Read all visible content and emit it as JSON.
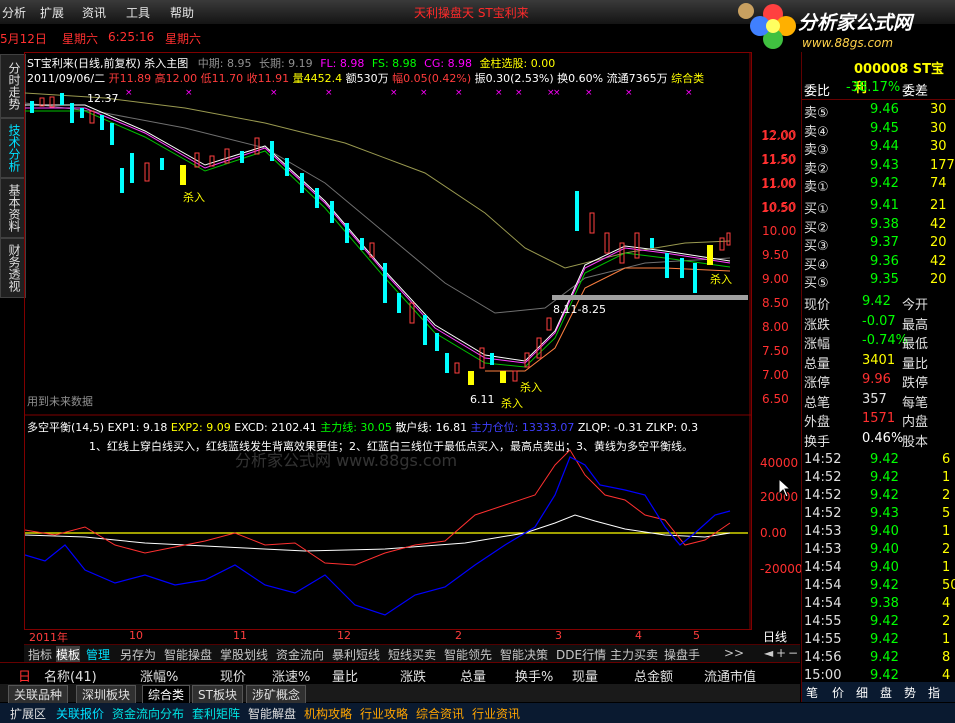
{
  "menu": [
    "分析",
    "扩展",
    "资讯",
    "工具",
    "帮助"
  ],
  "window_title": "天利操盘天 ST宝利来",
  "logo": {
    "text": "分析家公式网",
    "url": "www.88gs.com"
  },
  "datebar": {
    "date1": "5月12日",
    "day1": "星期六",
    "time": "6:25:16",
    "day2": "星期六"
  },
  "side_tabs": [
    "分时走势",
    "技术分析",
    "基本资料",
    "财务透视"
  ],
  "chart_header": {
    "title": "ST宝利来(日线,前复权) 杀入主图",
    "mid": "中期: 8.95",
    "long": "长期: 9.19",
    "fl": "FL: 8.98",
    "fs": "FS: 8.98",
    "cg": "CG: 8.98",
    "gold": "金柱选股: 0.00"
  },
  "quote_line": {
    "date": "2011/09/06/二",
    "open": "开11.89",
    "high": "高12.00",
    "low": "低11.70",
    "close": "收11.91",
    "vol": "量4452.4",
    "amt": "额530万",
    "amp": "幅0.05(0.42%)",
    "swing": "振0.30(2.53%)",
    "turn": "换0.60%",
    "float": "流通7365万",
    "cat": "综合类"
  },
  "price_axis": [
    "12.00",
    "11.50",
    "11.00",
    "10.50",
    "10.00",
    "9.50",
    "9.00",
    "8.50",
    "8.00",
    "7.50",
    "7.00",
    "6.50"
  ],
  "annotations": {
    "top": "12.37",
    "low_range": "8.11-8.25",
    "bottom": "6.11",
    "future": "用到未来数据",
    "buy": "杀入"
  },
  "indicator": {
    "name": "多空平衡(14,5)",
    "exp1": "EXP1: 9.18",
    "exp2": "EXP2: 9.09",
    "excd": "EXCD: 2102.41",
    "main": "主力线: 30.05",
    "retail": "散户线: 16.81",
    "pos": "主力仓位: 13333.07",
    "zlqp": "ZLQP: -0.31",
    "zlkp": "ZLKP: 0.3",
    "note": "1、红线上穿白线买入，红线蓝线发生背离效果更佳；2、红蓝白三线位于最低点买入，最高点卖出；3、黄线为多空平衡线。",
    "watermark": "分析家公式网 www.88gs.com",
    "axis": [
      "40000",
      "20000",
      "0.00",
      "-20000"
    ]
  },
  "time_axis": [
    "2011年",
    "10",
    "11",
    "12",
    "2",
    "3",
    "4",
    "5"
  ],
  "period": "日线",
  "tabbar": [
    "指标",
    "模板",
    "管理",
    "另存为",
    "智能操盘",
    "掌股划线",
    "资金流向",
    "暴利短线",
    "短线买卖",
    "智能领先",
    "智能决策",
    "DDE行情",
    "主力买卖",
    "操盘手",
    ">>"
  ],
  "list_header": [
    "名称(41)",
    "涨幅%",
    "现价",
    "涨速%",
    "量比",
    "涨跌",
    "总量",
    "换手%",
    "现量",
    "总金额",
    "流通市值"
  ],
  "sheet_tabs": [
    "关联品种",
    "深圳板块",
    "综合类",
    "ST板块",
    "涉矿概念"
  ],
  "status_bar": [
    "扩展区",
    "关联报价",
    "资金流向分布",
    "套利矩阵",
    "智能解盘",
    "机构攻略",
    "行业攻略",
    "综合资讯",
    "行业资讯"
  ],
  "right_panel": {
    "code": "000008 ST宝利",
    "weibi_label": "委比",
    "weibi": "-38.17%",
    "weicha": "委差",
    "sells": [
      {
        "label": "卖⑤",
        "price": "9.46",
        "vol": "30"
      },
      {
        "label": "卖④",
        "price": "9.45",
        "vol": "30"
      },
      {
        "label": "卖③",
        "price": "9.44",
        "vol": "30"
      },
      {
        "label": "卖②",
        "price": "9.43",
        "vol": "177"
      },
      {
        "label": "卖①",
        "price": "9.42",
        "vol": "74"
      }
    ],
    "buys": [
      {
        "label": "买①",
        "price": "9.41",
        "vol": "21"
      },
      {
        "label": "买②",
        "price": "9.38",
        "vol": "42"
      },
      {
        "label": "买③",
        "price": "9.37",
        "vol": "20"
      },
      {
        "label": "买④",
        "price": "9.36",
        "vol": "42"
      },
      {
        "label": "买⑤",
        "price": "9.35",
        "vol": "20"
      }
    ],
    "stats": [
      {
        "l": "现价",
        "v": "9.42",
        "r": "今开"
      },
      {
        "l": "涨跌",
        "v": "-0.07",
        "r": "最高"
      },
      {
        "l": "涨幅",
        "v": "-0.74%",
        "r": "最低"
      },
      {
        "l": "总量",
        "v": "3401",
        "r": "量比"
      },
      {
        "l": "涨停",
        "v": "9.96",
        "r": "跌停"
      },
      {
        "l": "总笔",
        "v": "357",
        "r": "每笔"
      },
      {
        "l": "外盘",
        "v": "1571",
        "r": "内盘"
      },
      {
        "l": "换手",
        "v": "0.46%",
        "r": "股本"
      }
    ],
    "ticks": [
      {
        "t": "14:52",
        "p": "9.42",
        "v": "6"
      },
      {
        "t": "14:52",
        "p": "9.42",
        "v": "1"
      },
      {
        "t": "14:52",
        "p": "9.42",
        "v": "2"
      },
      {
        "t": "14:52",
        "p": "9.43",
        "v": "5"
      },
      {
        "t": "14:53",
        "p": "9.40",
        "v": "1"
      },
      {
        "t": "14:53",
        "p": "9.40",
        "v": "2"
      },
      {
        "t": "14:54",
        "p": "9.40",
        "v": "1"
      },
      {
        "t": "14:54",
        "p": "9.42",
        "v": "50"
      },
      {
        "t": "14:54",
        "p": "9.38",
        "v": "4"
      },
      {
        "t": "14:55",
        "p": "9.42",
        "v": "2"
      },
      {
        "t": "14:55",
        "p": "9.42",
        "v": "1"
      },
      {
        "t": "14:56",
        "p": "9.42",
        "v": "8"
      },
      {
        "t": "15:00",
        "p": "9.42",
        "v": "4"
      }
    ],
    "bottom_tabs": [
      "笔",
      "价",
      "细",
      "盘",
      "势",
      "指"
    ]
  }
}
